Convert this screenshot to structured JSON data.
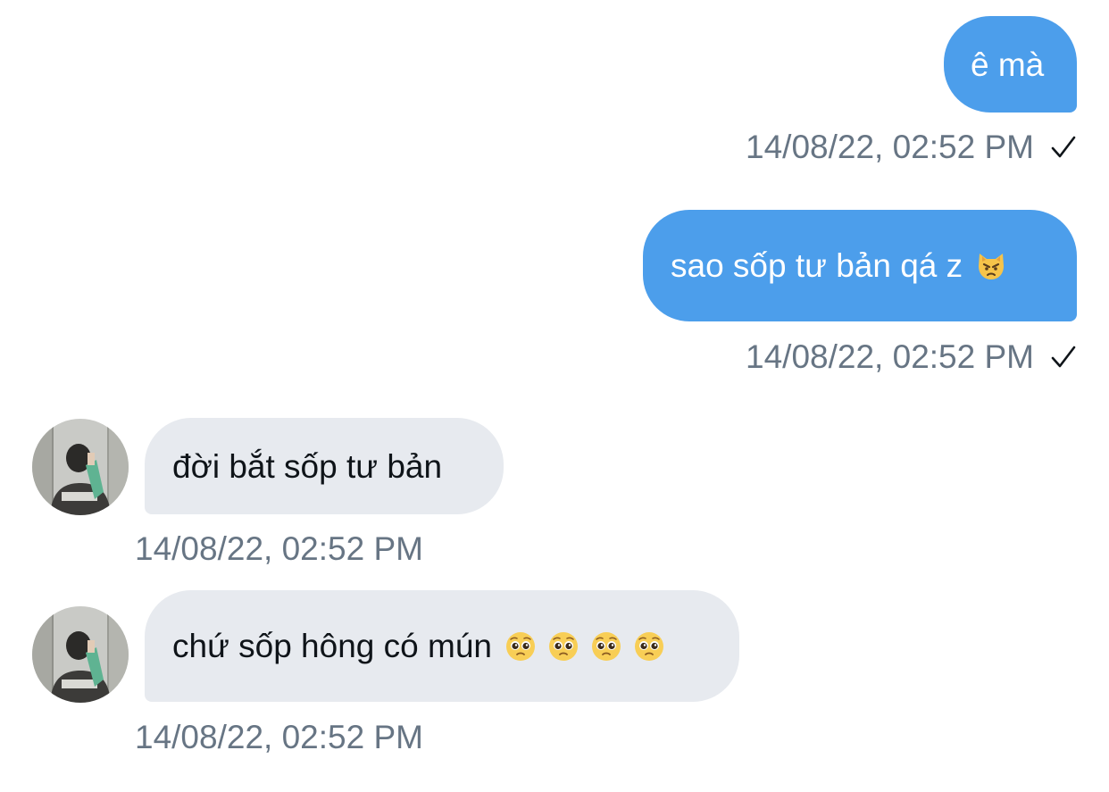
{
  "messages": [
    {
      "direction": "outgoing",
      "text": "ê mà",
      "timestamp": "14/08/22, 02:52 PM",
      "status_icon": "check-icon"
    },
    {
      "direction": "outgoing",
      "text": "sao sốp tư bản qá z",
      "emoji": [
        "pouting-cat-emoji"
      ],
      "timestamp": "14/08/22, 02:52 PM",
      "status_icon": "check-icon"
    },
    {
      "direction": "incoming",
      "text": "đời bắt sốp tư bản",
      "timestamp": "14/08/22, 02:52 PM",
      "avatar": "contact-avatar"
    },
    {
      "direction": "incoming",
      "text": "chứ sốp hông có mún",
      "emoji": [
        "pleading-face-emoji",
        "pleading-face-emoji",
        "pleading-face-emoji",
        "pleading-face-emoji"
      ],
      "timestamp": "14/08/22, 02:52 PM",
      "avatar": "contact-avatar"
    }
  ],
  "colors": {
    "outgoing_bubble": "#4c9eeb",
    "incoming_bubble": "#e7eaef",
    "timestamp_text": "#677584"
  }
}
